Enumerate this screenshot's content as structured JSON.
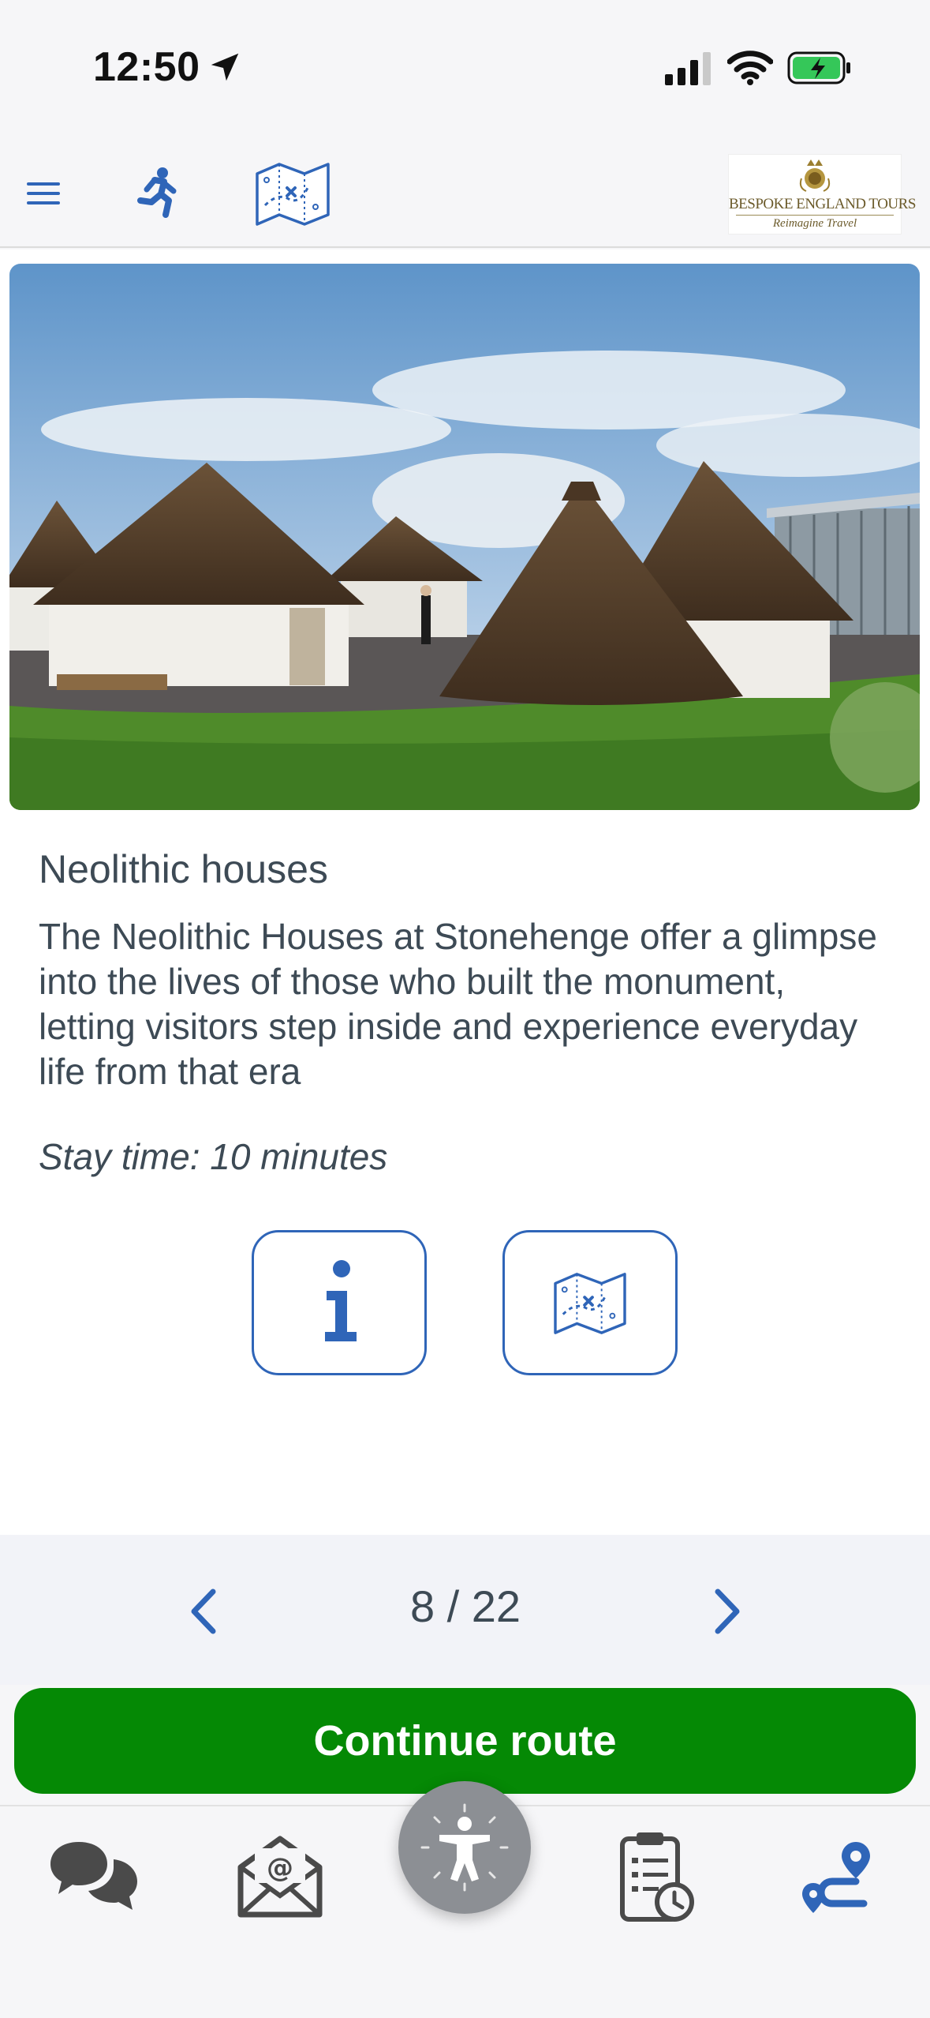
{
  "status_bar": {
    "time": "12:50"
  },
  "header": {
    "logo": {
      "title": "BESPOKE ENGLAND TOURS",
      "tagline": "Reimagine Travel"
    }
  },
  "place": {
    "title": "Neolithic houses",
    "description": "The Neolithic Houses at Stonehenge offer a glimpse into the lives of those who built the monument, letting visitors step inside and experience everyday life from that era",
    "stay_time": "Stay time: 10 minutes"
  },
  "pager": {
    "count": "8 / 22"
  },
  "continue_button": {
    "label": "Continue route"
  },
  "colors": {
    "accent": "#2f65b8",
    "continue": "#058905",
    "text": "#3d4a55",
    "a11y": "#8c8f94"
  },
  "icons": {
    "header": [
      "menu-icon",
      "runner-icon",
      "map-icon"
    ],
    "actions": [
      "info-icon",
      "map-icon"
    ],
    "tabs": [
      "chat-icon",
      "mail-icon",
      "accessibility-icon",
      "clipboard-clock-icon",
      "route-icon"
    ]
  }
}
